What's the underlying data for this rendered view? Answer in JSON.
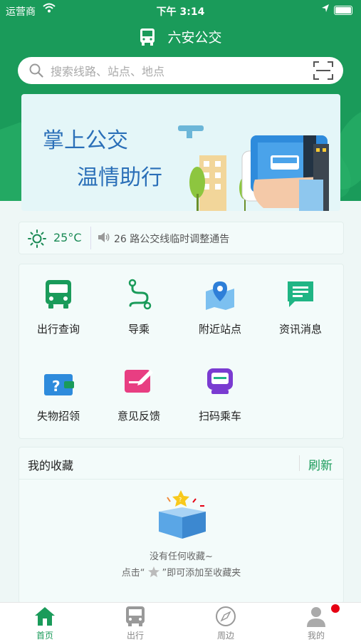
{
  "status_bar": {
    "carrier": "运营商",
    "time": "下午 3:14"
  },
  "app": {
    "title": "六安公交"
  },
  "search": {
    "placeholder": "搜索线路、站点、地点"
  },
  "banner": {
    "line1": "掌上公交",
    "line2": "温情助行"
  },
  "info": {
    "temperature": "25°C",
    "notice": "26 路公交线临时调整通告"
  },
  "services": [
    {
      "label": "出行查询",
      "icon": "bus-icon"
    },
    {
      "label": "导乘",
      "icon": "route-icon"
    },
    {
      "label": "附近站点",
      "icon": "map-pin-icon"
    },
    {
      "label": "资讯消息",
      "icon": "message-icon"
    },
    {
      "label": "失物招领",
      "icon": "wallet-icon"
    },
    {
      "label": "意见反馈",
      "icon": "edit-icon"
    },
    {
      "label": "扫码乘车",
      "icon": "scan-ride-icon"
    }
  ],
  "favorites": {
    "title": "我的收藏",
    "refresh": "刷新",
    "empty_line1": "没有任何收藏~",
    "empty_line2_prefix": "点击“",
    "empty_line2_suffix": "”即可添加至收藏夹"
  },
  "tabs": [
    {
      "label": "首页",
      "icon": "home-icon",
      "active": true
    },
    {
      "label": "出行",
      "icon": "bus-icon",
      "active": false
    },
    {
      "label": "周边",
      "icon": "compass-icon",
      "active": false
    },
    {
      "label": "我的",
      "icon": "user-icon",
      "active": false
    }
  ],
  "colors": {
    "brand": "#1a9b5a",
    "banner_text": "#2a6fb8",
    "badge": "#e60012"
  }
}
